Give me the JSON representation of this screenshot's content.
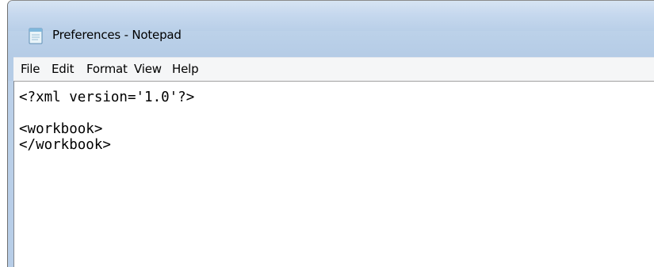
{
  "window": {
    "title": "Preferences - Notepad",
    "app_icon": "notepad-icon"
  },
  "menu": {
    "items": [
      "File",
      "Edit",
      "Format",
      "View",
      "Help"
    ]
  },
  "editor": {
    "content": "<?xml version='1.0'?>\n\n<workbook>\n</workbook>"
  },
  "colors": {
    "frame": "#b9cfe8",
    "menubar": "#f5f6f7",
    "editor_bg": "#ffffff"
  }
}
